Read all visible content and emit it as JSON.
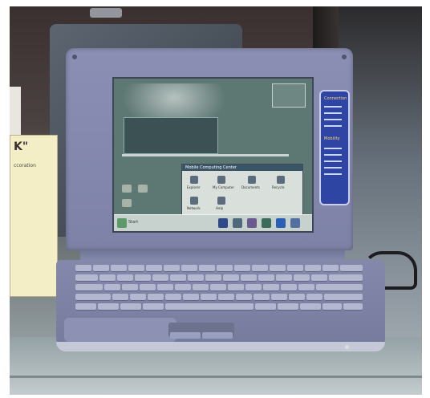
{
  "photo": {
    "description_visible_text": {
      "sign_letter": "K\"",
      "sign_sub": "ccoration"
    }
  },
  "laptop": {
    "screen": {
      "explorer_title": "Mobile Computing Center",
      "explorer_items": [
        "Explorer",
        "My Computer",
        "Documents",
        "Recycle",
        "Network",
        "Help"
      ],
      "taskbar_text": "Start"
    },
    "side_panel": {
      "heading_1": "Connection",
      "heading_2": "Mobility"
    }
  },
  "colors": {
    "chassis": "#8489ab",
    "screen_background": "#5d7773",
    "side_panel": "#2f45a3"
  }
}
